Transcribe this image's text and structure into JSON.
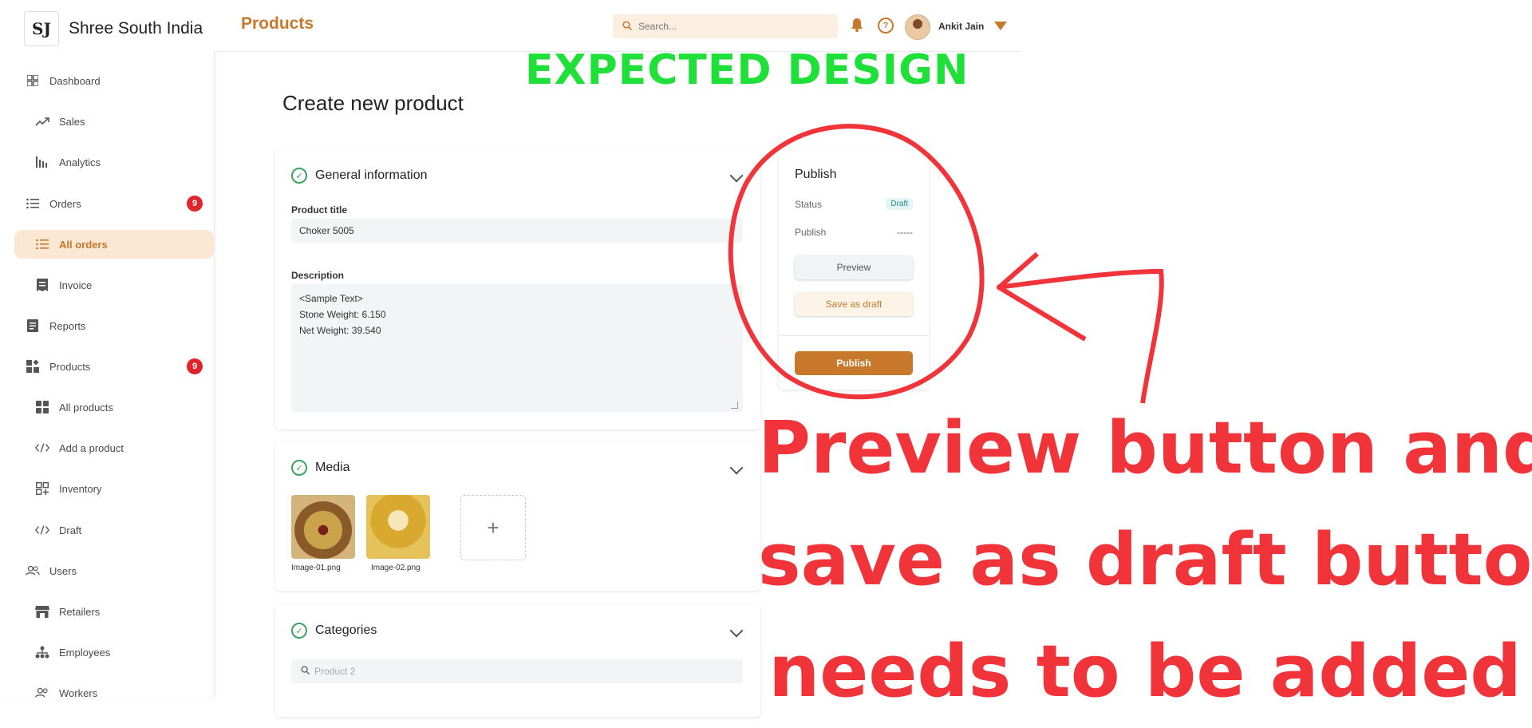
{
  "brand": {
    "name": "Shree South India",
    "logo_text": "SJ"
  },
  "sidebar": {
    "items": [
      {
        "label": "Dashboard",
        "icon": "grid-icon"
      },
      {
        "label": "Sales",
        "icon": "trend-up-icon"
      },
      {
        "label": "Analytics",
        "icon": "bar-chart-icon"
      },
      {
        "label": "Orders",
        "icon": "list-icon",
        "badge": "9"
      },
      {
        "label": "All orders",
        "icon": "list-icon",
        "active": true
      },
      {
        "label": "Invoice",
        "icon": "invoice-icon"
      },
      {
        "label": "Reports",
        "icon": "document-icon"
      },
      {
        "label": "Products",
        "icon": "products-icon",
        "badge": "9"
      },
      {
        "label": "All products",
        "icon": "tiles-icon"
      },
      {
        "label": "Add a product",
        "icon": "code-icon"
      },
      {
        "label": "Inventory",
        "icon": "inventory-icon"
      },
      {
        "label": "Draft",
        "icon": "code-icon"
      },
      {
        "label": "Users",
        "icon": "users-icon"
      },
      {
        "label": "Retailers",
        "icon": "store-icon"
      },
      {
        "label": "Employees",
        "icon": "hierarchy-icon"
      },
      {
        "label": "Workers",
        "icon": "users-icon"
      }
    ]
  },
  "header": {
    "title": "Products",
    "search_placeholder": "Search...",
    "user_name": "Ankit Jain"
  },
  "banner": {
    "text": "EXPECTED DESIGN"
  },
  "main": {
    "title": "Create new product",
    "general": {
      "heading": "General information",
      "product_title_label": "Product title",
      "product_title_value": "Choker 5005",
      "description_label": "Description",
      "description_lines": [
        "<Sample Text>",
        "Stone Weight: 6.150",
        "Net Weight: 39.540"
      ]
    },
    "media": {
      "heading": "Media",
      "images": [
        "Image-01.png",
        "Image-02.png"
      ],
      "add_label": "+"
    },
    "categories": {
      "heading": "Categories",
      "search_placeholder": "Product 2"
    }
  },
  "publish": {
    "heading": "Publish",
    "status_label": "Status",
    "status_value": "Draft",
    "publish_label": "Publish",
    "publish_value": "-----",
    "preview_button": "Preview",
    "draft_button": "Save as draft",
    "publish_button": "Publish"
  },
  "annotation": {
    "lines": [
      "Preview button and",
      "save as draft button",
      "needs to be added"
    ],
    "color": "#f0343a"
  },
  "colors": {
    "accent": "#c8782a",
    "accent_light": "#fbe7d3",
    "badge": "#e0242c",
    "banner": "#1fe038"
  }
}
